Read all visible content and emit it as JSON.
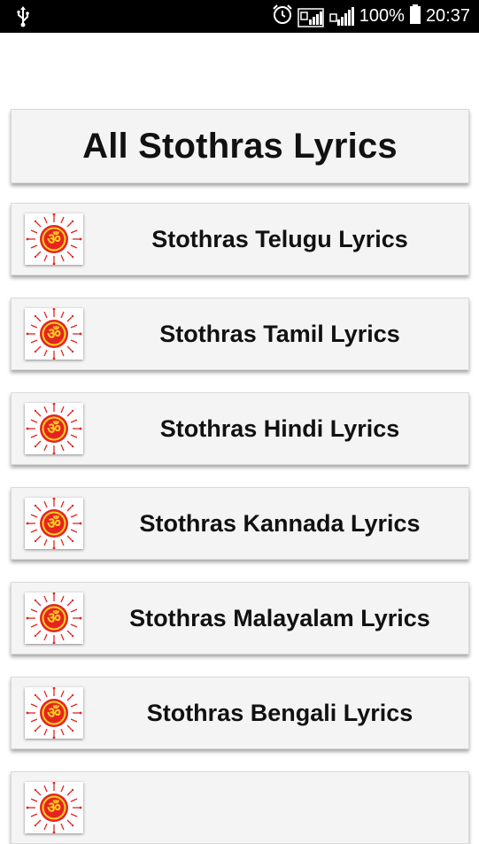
{
  "status_bar": {
    "battery_percent": "100%",
    "time": "20:37",
    "icons": [
      "usb-icon",
      "alarm-icon",
      "signal-icon",
      "battery-icon"
    ]
  },
  "header": {
    "title": "All Stothras Lyrics"
  },
  "list": {
    "icon_name": "om-icon",
    "items": [
      {
        "label": "Stothras Telugu Lyrics"
      },
      {
        "label": "Stothras Tamil Lyrics"
      },
      {
        "label": "Stothras Hindi Lyrics"
      },
      {
        "label": "Stothras Kannada Lyrics"
      },
      {
        "label": "Stothras Malayalam Lyrics"
      },
      {
        "label": "Stothras Bengali Lyrics"
      },
      {
        "label": ""
      }
    ]
  },
  "colors": {
    "status_bar_bg": "#000000",
    "card_bg": "#f4f4f4",
    "text": "#111111",
    "om_red": "#e52421",
    "om_yellow": "#ffd21f"
  }
}
